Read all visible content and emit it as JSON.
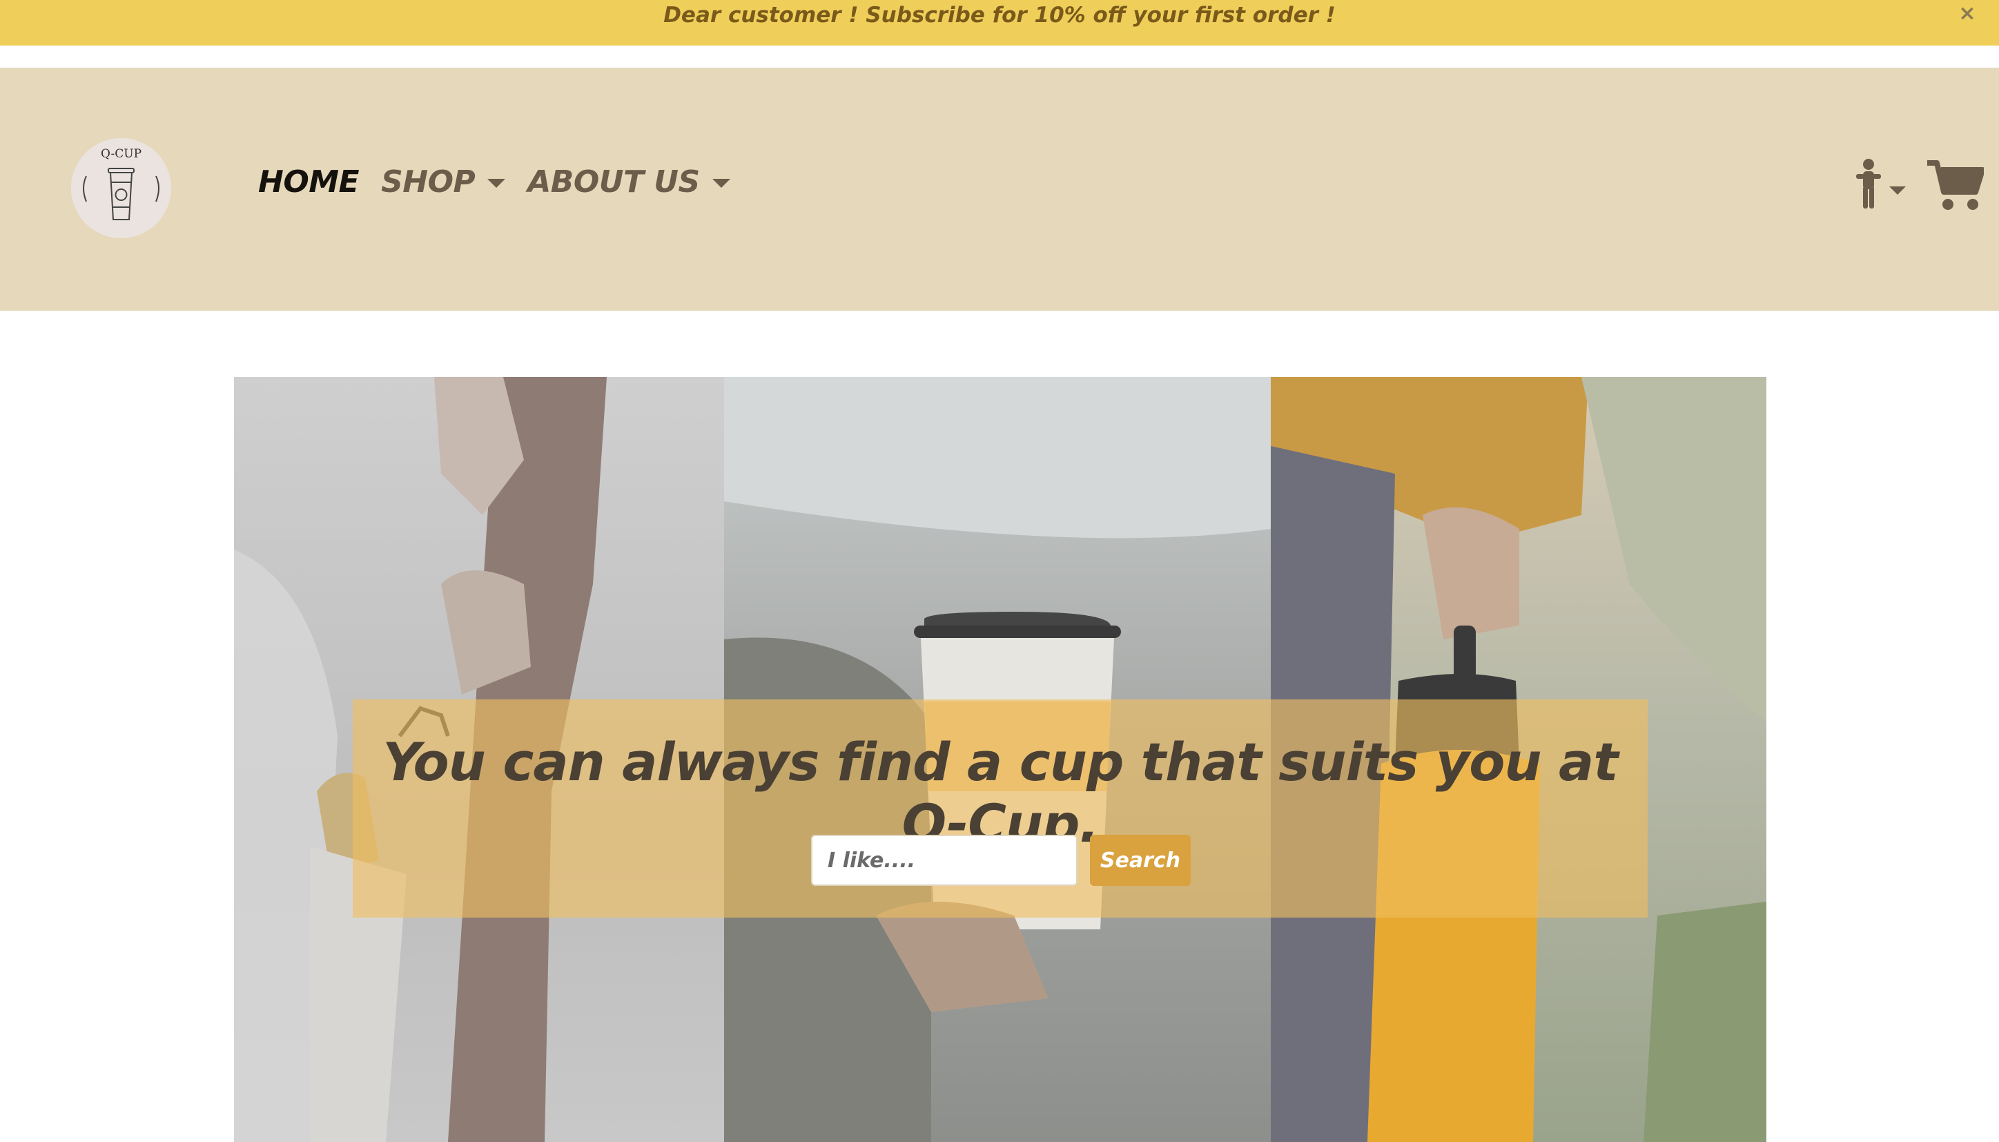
{
  "announcement": {
    "text": "Dear customer ! Subscribe for 10% off your first order !",
    "close_label": "×"
  },
  "logo": {
    "text": "Q-CUP",
    "icon": "coffee-cup-logo"
  },
  "nav": {
    "items": [
      {
        "label": "HOME",
        "active": true,
        "has_dropdown": false
      },
      {
        "label": "SHOP",
        "active": false,
        "has_dropdown": true
      },
      {
        "label": "ABOUT US",
        "active": false,
        "has_dropdown": true
      }
    ]
  },
  "header_icons": {
    "user": "accessibility-person-icon",
    "cart": "shopping-cart-icon"
  },
  "hero": {
    "title": "You can always find a cup that suits you at Q-Cup.",
    "search": {
      "placeholder": "I like....",
      "value": "",
      "button_label": "Search"
    }
  },
  "colors": {
    "announcement_bg": "#efcf5a",
    "header_bg": "#e6d8bb",
    "overlay": "#f0be5f",
    "search_button": "#d9a23e"
  }
}
